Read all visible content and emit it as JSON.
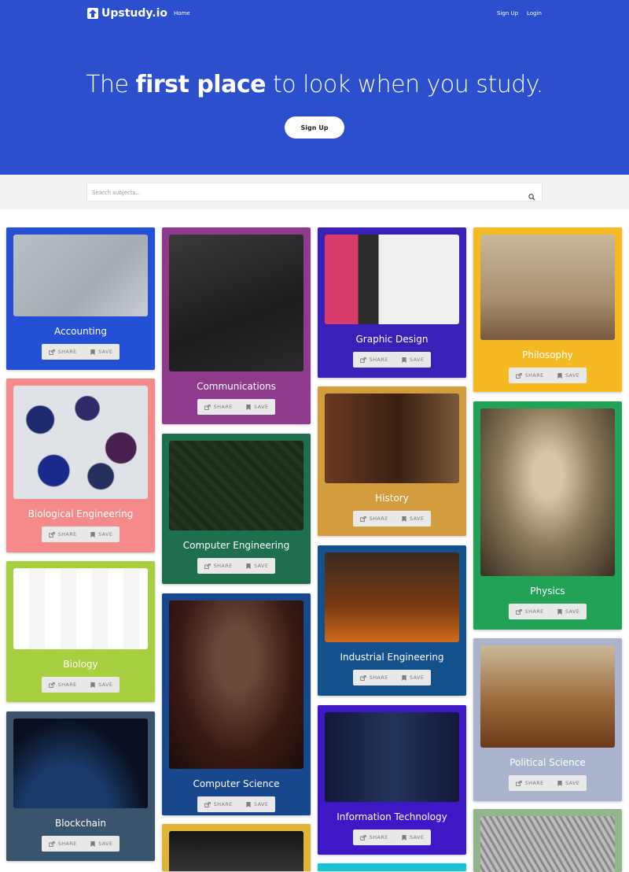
{
  "nav": {
    "brand": "Upstudy.io",
    "home": "Home",
    "signup": "Sign Up",
    "login": "Login"
  },
  "hero": {
    "headline_pre": "The ",
    "headline_bold": "first place",
    "headline_post": " to look when you study.",
    "cta": "Sign Up"
  },
  "search": {
    "placeholder": "Search subjects..."
  },
  "card_actions": {
    "share": "SHARE",
    "save": "SAVE"
  },
  "subjects": [
    {
      "title": "Accounting",
      "bg": "#2450d6",
      "text": "#ffffff"
    },
    {
      "title": "Biological Engineering",
      "bg": "#f48a8a",
      "text": "#ffffff"
    },
    {
      "title": "Biology",
      "bg": "#a8cf3f",
      "text": "#ffffff"
    },
    {
      "title": "Blockchain",
      "bg": "#3b546d",
      "text": "#ffffff"
    },
    {
      "title": "Communications",
      "bg": "#8e3b8e",
      "text": "#ffffff"
    },
    {
      "title": "Computer Engineering",
      "bg": "#1f6f4f",
      "text": "#ffffff"
    },
    {
      "title": "Computer Science",
      "bg": "#17478c",
      "text": "#ffffff"
    },
    {
      "title": "Graphic Design",
      "bg": "#3b20b8",
      "text": "#ffffff"
    },
    {
      "title": "History",
      "bg": "#d39c3c",
      "text": "#ffffff"
    },
    {
      "title": "Industrial Engineering",
      "bg": "#14508c",
      "text": "#ffffff"
    },
    {
      "title": "Information Technology",
      "bg": "#3d18c4",
      "text": "#ffffff"
    },
    {
      "title": "Philosophy",
      "bg": "#f5b922",
      "text": "#ffffff"
    },
    {
      "title": "Physics",
      "bg": "#21a256",
      "text": "#ffffff"
    },
    {
      "title": "Political Science",
      "bg": "#a9b3cc",
      "text": "#ffffff"
    }
  ]
}
